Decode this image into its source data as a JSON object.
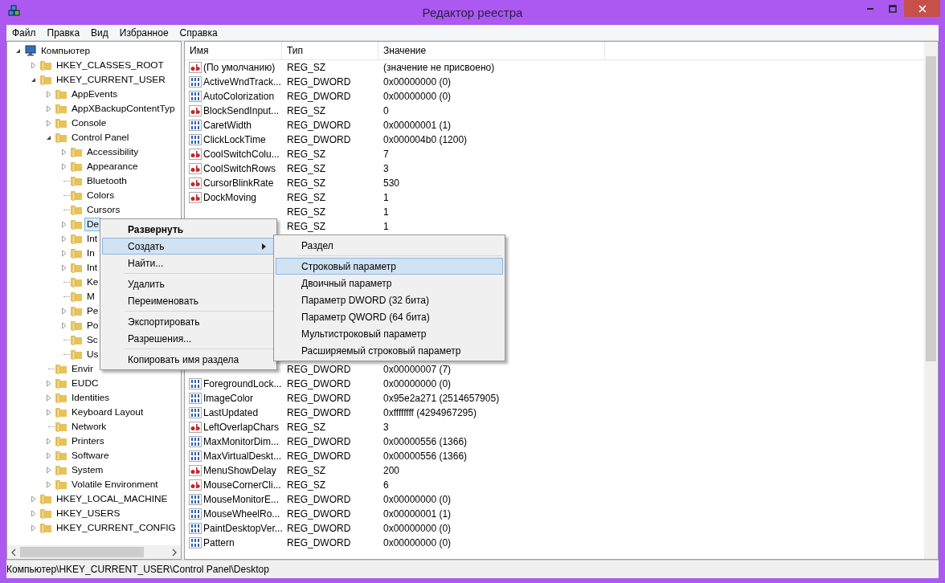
{
  "window": {
    "title": "Редактор реестра"
  },
  "menu_bar": [
    "Файл",
    "Правка",
    "Вид",
    "Избранное",
    "Справка"
  ],
  "tree": [
    {
      "label": "Компьютер",
      "kind": "expanded",
      "selected": false,
      "children": [
        {
          "label": "HKEY_CLASSES_ROOT",
          "kind": "collapsed",
          "selected": false
        },
        {
          "label": "HKEY_CURRENT_USER",
          "kind": "expanded",
          "selected": false,
          "children": [
            {
              "label": "AppEvents",
              "kind": "collapsed",
              "selected": false
            },
            {
              "label": "AppXBackupContentTyp",
              "kind": "collapsed",
              "selected": false
            },
            {
              "label": "Console",
              "kind": "collapsed",
              "selected": false
            },
            {
              "label": "Control Panel",
              "kind": "expanded",
              "selected": false,
              "children": [
                {
                  "label": "Accessibility",
                  "kind": "collapsed",
                  "selected": false
                },
                {
                  "label": "Appearance",
                  "kind": "collapsed",
                  "selected": false
                },
                {
                  "label": "Bluetooth",
                  "kind": "leaf",
                  "selected": false
                },
                {
                  "label": "Colors",
                  "kind": "leaf",
                  "selected": false
                },
                {
                  "label": "Cursors",
                  "kind": "leaf",
                  "selected": false
                },
                {
                  "label": "De",
                  "kind": "collapsed",
                  "selected": true
                },
                {
                  "label": "Int",
                  "kind": "collapsed",
                  "selected": false
                },
                {
                  "label": "In",
                  "kind": "collapsed",
                  "selected": false
                },
                {
                  "label": "Int",
                  "kind": "collapsed",
                  "selected": false
                },
                {
                  "label": "Ke",
                  "kind": "leaf",
                  "selected": false
                },
                {
                  "label": "M",
                  "kind": "leaf",
                  "selected": false
                },
                {
                  "label": "Pe",
                  "kind": "collapsed",
                  "selected": false
                },
                {
                  "label": "Po",
                  "kind": "collapsed",
                  "selected": false
                },
                {
                  "label": "Sc",
                  "kind": "leaf",
                  "selected": false
                },
                {
                  "label": "Us",
                  "kind": "leaf",
                  "selected": false
                }
              ]
            },
            {
              "label": "Envir",
              "kind": "leaf",
              "selected": false
            },
            {
              "label": "EUDC",
              "kind": "collapsed",
              "selected": false
            },
            {
              "label": "Identities",
              "kind": "collapsed",
              "selected": false
            },
            {
              "label": "Keyboard Layout",
              "kind": "collapsed",
              "selected": false
            },
            {
              "label": "Network",
              "kind": "leaf",
              "selected": false
            },
            {
              "label": "Printers",
              "kind": "collapsed",
              "selected": false
            },
            {
              "label": "Software",
              "kind": "collapsed",
              "selected": false
            },
            {
              "label": "System",
              "kind": "collapsed",
              "selected": false
            },
            {
              "label": "Volatile Environment",
              "kind": "collapsed",
              "selected": false
            }
          ]
        },
        {
          "label": "HKEY_LOCAL_MACHINE",
          "kind": "collapsed",
          "selected": false
        },
        {
          "label": "HKEY_USERS",
          "kind": "collapsed",
          "selected": false
        },
        {
          "label": "HKEY_CURRENT_CONFIG",
          "kind": "collapsed",
          "selected": false
        }
      ]
    }
  ],
  "table": {
    "columns": [
      "Имя",
      "Тип",
      "Значение"
    ],
    "rows_above_menu": [
      {
        "kind": "sz",
        "name": "(По умолчанию)",
        "type": "REG_SZ",
        "value": "(значение не присвоено)"
      },
      {
        "kind": "dword",
        "name": "ActiveWndTrack...",
        "type": "REG_DWORD",
        "value": "0x00000000 (0)"
      },
      {
        "kind": "dword",
        "name": "AutoColorization",
        "type": "REG_DWORD",
        "value": "0x00000000 (0)"
      },
      {
        "kind": "sz",
        "name": "BlockSendInput...",
        "type": "REG_SZ",
        "value": "0"
      },
      {
        "kind": "dword",
        "name": "CaretWidth",
        "type": "REG_DWORD",
        "value": "0x00000001 (1)"
      },
      {
        "kind": "dword",
        "name": "ClickLockTime",
        "type": "REG_DWORD",
        "value": "0x000004b0 (1200)"
      },
      {
        "kind": "sz",
        "name": "CoolSwitchColu...",
        "type": "REG_SZ",
        "value": "7"
      },
      {
        "kind": "sz",
        "name": "CoolSwitchRows",
        "type": "REG_SZ",
        "value": "3"
      },
      {
        "kind": "sz",
        "name": "CursorBlinkRate",
        "type": "REG_SZ",
        "value": "530"
      },
      {
        "kind": "sz",
        "name": "DockMoving",
        "type": "REG_SZ",
        "value": "1"
      },
      {
        "type": "REG_SZ",
        "value": "1"
      },
      {
        "type": "REG_SZ",
        "value": "1"
      }
    ],
    "rows_below_menu": [
      {
        "type": "REG_DWORD",
        "value": "0x00000007 (7)"
      },
      {
        "kind": "dword",
        "name": "ForegroundLock...",
        "type": "REG_DWORD",
        "value": "0x00000000 (0)"
      },
      {
        "kind": "dword",
        "name": "ImageColor",
        "type": "REG_DWORD",
        "value": "0x95e2a271 (2514657905)"
      },
      {
        "kind": "dword",
        "name": "LastUpdated",
        "type": "REG_DWORD",
        "value": "0xffffffff (4294967295)"
      },
      {
        "kind": "sz",
        "name": "LeftOverlapChars",
        "type": "REG_SZ",
        "value": "3"
      },
      {
        "kind": "dword",
        "name": "MaxMonitorDim...",
        "type": "REG_DWORD",
        "value": "0x00000556 (1366)"
      },
      {
        "kind": "dword",
        "name": "MaxVirtualDeskt...",
        "type": "REG_DWORD",
        "value": "0x00000556 (1366)"
      },
      {
        "kind": "sz",
        "name": "MenuShowDelay",
        "type": "REG_SZ",
        "value": "200"
      },
      {
        "kind": "sz",
        "name": "MouseCornerCli...",
        "type": "REG_SZ",
        "value": "6"
      },
      {
        "kind": "dword",
        "name": "MouseMonitorE...",
        "type": "REG_DWORD",
        "value": "0x00000000 (0)"
      },
      {
        "kind": "dword",
        "name": "MouseWheelRo...",
        "type": "REG_DWORD",
        "value": "0x00000001 (1)"
      },
      {
        "kind": "dword",
        "name": "PaintDesktopVer...",
        "type": "REG_DWORD",
        "value": "0x00000000 (0)"
      },
      {
        "kind": "dword",
        "name": "Pattern",
        "type": "REG_DWORD",
        "value": "0x00000000 (0)"
      }
    ]
  },
  "context_menu": [
    {
      "kind": "item",
      "label": "Развернуть",
      "bold": true,
      "selected": false,
      "submenu": false
    },
    {
      "kind": "item",
      "label": "Создать",
      "bold": false,
      "selected": true,
      "submenu": true
    },
    {
      "kind": "item",
      "label": "Найти...",
      "bold": false,
      "selected": false,
      "submenu": false
    },
    {
      "kind": "separator"
    },
    {
      "kind": "item",
      "label": "Удалить",
      "bold": false,
      "selected": false,
      "submenu": false
    },
    {
      "kind": "item",
      "label": "Переименовать",
      "bold": false,
      "selected": false,
      "submenu": false
    },
    {
      "kind": "separator"
    },
    {
      "kind": "item",
      "label": "Экспортировать",
      "bold": false,
      "selected": false,
      "submenu": false
    },
    {
      "kind": "item",
      "label": "Разрешения...",
      "bold": false,
      "selected": false,
      "submenu": false
    },
    {
      "kind": "separator"
    },
    {
      "kind": "item",
      "label": "Копировать имя раздела",
      "bold": false,
      "selected": false,
      "submenu": false
    }
  ],
  "submenu": [
    {
      "kind": "item",
      "label": "Раздел",
      "selected": false
    },
    {
      "kind": "separator"
    },
    {
      "kind": "item",
      "label": "Строковый параметр",
      "selected": true
    },
    {
      "kind": "item",
      "label": "Двоичный параметр",
      "selected": false
    },
    {
      "kind": "item",
      "label": "Параметр DWORD (32 бита)",
      "selected": false
    },
    {
      "kind": "item",
      "label": "Параметр QWORD (64 бита)",
      "selected": false
    },
    {
      "kind": "item",
      "label": "Мультистроковый параметр",
      "selected": false
    },
    {
      "kind": "item",
      "label": "Расширяемый строковый параметр",
      "selected": false
    }
  ],
  "status_bar": "Компьютер\\HKEY_CURRENT_USER\\Control Panel\\Desktop"
}
